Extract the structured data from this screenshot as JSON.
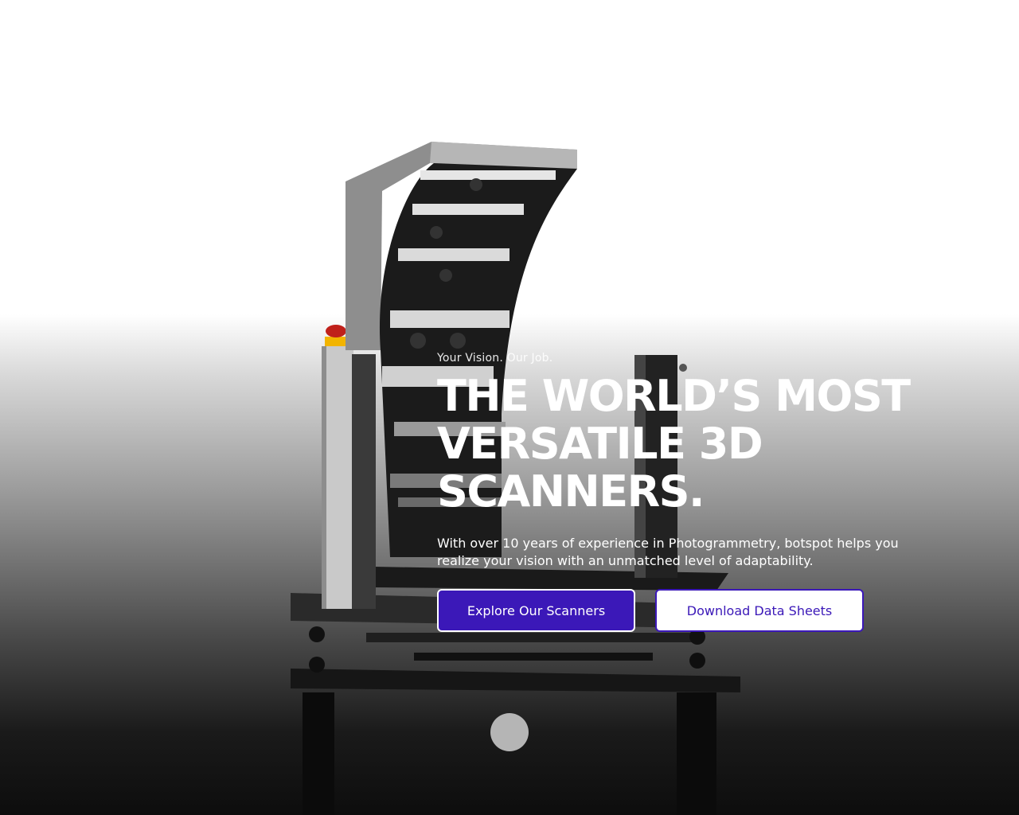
{
  "hero": {
    "eyebrow": "Your Vision. Our Job.",
    "headline_lines": [
      "THE WORLD’S MOST",
      "VERSATILE 3D",
      "SCANNERS."
    ],
    "description": "With over 10 years of experience in Photogrammetry, botspot helps you realize your vision with an unmatched level of adaptability.",
    "primary_button": "Explore Our Scanners",
    "secondary_button": "Download Data Sheets",
    "image_subject": "3D scanner machine",
    "scroll_indicator_icon": "circle-icon"
  },
  "colors": {
    "accent": "#3b18b8",
    "text_light": "#ffffff",
    "scroll_dot": "#b5b5b5"
  }
}
